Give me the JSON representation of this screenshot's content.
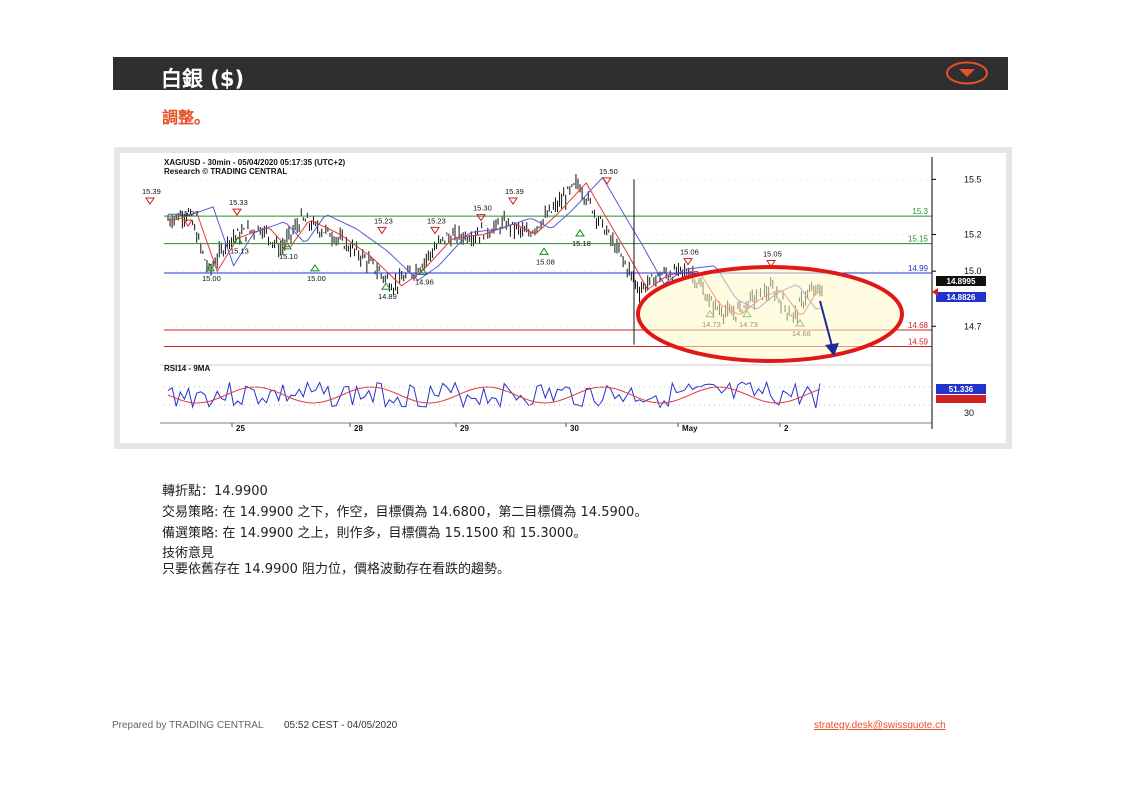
{
  "header": {
    "title": "白銀 ($)",
    "subtitle": "調整。"
  },
  "chart_data": {
    "type": "candlestick",
    "title_line1": "XAG/USD - 30min - 05/04/2020 05:17:35 (UTC+2)",
    "title_line2": "Research © TRADING CENTRAL",
    "y_ticks": [
      "15.5",
      "15.2",
      "15.0",
      "14.7"
    ],
    "ylim": [
      14.5,
      15.6
    ],
    "x_labels": [
      "25",
      "28",
      "29",
      "30",
      "May",
      "2"
    ],
    "levels": [
      {
        "label": "15.3",
        "value": 15.3,
        "color": "#2a8c2a"
      },
      {
        "label": "15.15",
        "value": 15.15,
        "color": "#2a8c2a"
      },
      {
        "label": "14.99",
        "value": 14.99,
        "color": "#2233cc"
      },
      {
        "label": "14.68",
        "value": 14.68,
        "color": "#cc2222"
      },
      {
        "label": "14.59",
        "value": 14.59,
        "color": "#cc2222"
      }
    ],
    "price_boxes": [
      {
        "label": "14.8995",
        "color": "#111111"
      },
      {
        "label": "14.8826",
        "color": "#2233cc"
      }
    ],
    "pivot_highs": [
      "15.39",
      "15.27",
      "15.33",
      "15.23",
      "15.23",
      "15.30",
      "15.39",
      "15.50",
      "15.06",
      "15.05"
    ],
    "pivot_lows": [
      "15.00",
      "15.13",
      "15.10",
      "15.00",
      "14.89",
      "14.96",
      "15.08",
      "15.18",
      "14.73",
      "14.73",
      "14.68"
    ],
    "rsi_label": "RSI14 - 9MA",
    "rsi_ticks": [
      "30"
    ],
    "rsi_boxes": [
      {
        "label": "51.336",
        "color": "#2233cc"
      }
    ]
  },
  "text": {
    "pivot": "轉折點：14.9900",
    "strategy": "交易策略: 在 14.9900 之下，作空，目標價為 14.6800，第二目標價為 14.5900。",
    "alt_strategy": "備選策略: 在 14.9900 之上，則作多，目標價為 15.1500 和 15.3000。",
    "comment_title": "技術意見",
    "comment": "只要依舊存在 14.9900 阻力位，價格波動存在看跌的趨勢。"
  },
  "footer": {
    "prepared": "Prepared by TRADING CENTRAL",
    "timestamp": "05:52 CEST - 04/05/2020",
    "email": "strategy.desk@swissquote.ch"
  },
  "colors": {
    "accent": "#e8502a",
    "header_bg": "#2f2f2f"
  }
}
